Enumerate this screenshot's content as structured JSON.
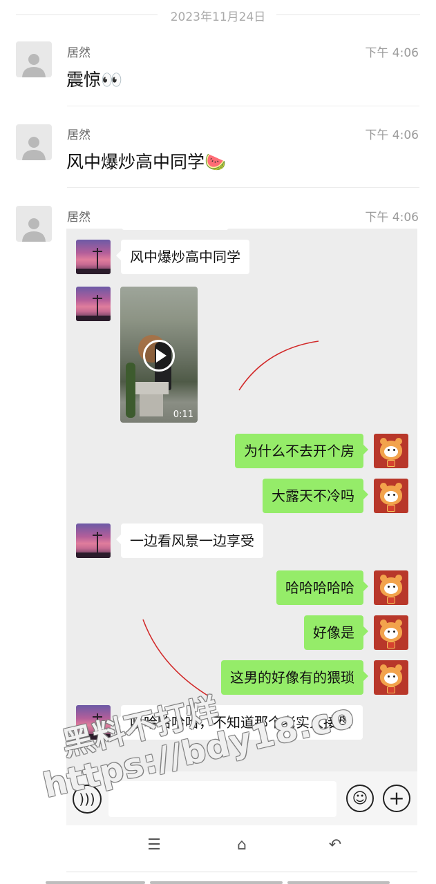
{
  "date_header": "2023年11月24日",
  "messages": [
    {
      "sender": "居然",
      "time": "下午 4:06",
      "text": "震惊👀"
    },
    {
      "sender": "居然",
      "time": "下午 4:06",
      "text": "风中爆炒高中同学🍉"
    },
    {
      "sender": "居然",
      "time": "下午 4:06"
    }
  ],
  "forwarded": {
    "first_text": "风中爆炒高中同学",
    "video_duration": "0:11",
    "bubbles": [
      {
        "side": "right",
        "text": "为什么不去开个房"
      },
      {
        "side": "right",
        "text": "大露天不冷吗"
      },
      {
        "side": "left",
        "text": "一边看风景一边享受"
      },
      {
        "side": "right",
        "text": "哈哈哈哈哈"
      },
      {
        "side": "right",
        "text": "好像是"
      },
      {
        "side": "right",
        "text": "这男的好像有的猥琐"
      },
      {
        "side": "left",
        "text": "哈哈哈哈哈，不知道那个老实人接盘"
      }
    ]
  },
  "watermark": {
    "line1": "黑料不打烊",
    "line2": "https://bdy18.co"
  },
  "icons": {
    "voice": "voice-icon",
    "emoji": "emoji-icon",
    "plus": "plus-icon",
    "menu": "menu-icon",
    "home": "home-icon",
    "back": "back-icon"
  },
  "colors": {
    "green_bubble": "#95ec69",
    "panel_bg": "#ededed",
    "annotation": "#d22a2a"
  }
}
